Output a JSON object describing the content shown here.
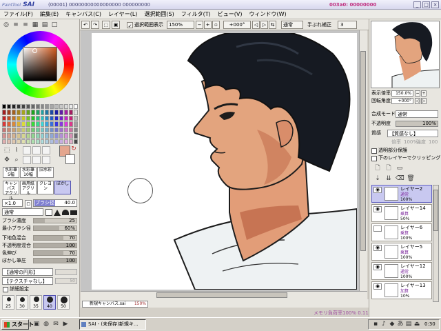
{
  "title_bar": {
    "logo_small": "PaintTool",
    "logo_big": "SAI",
    "title_text": "(00001) 00000000000000000 000000000",
    "memory_text": "003a0: 00000000"
  },
  "menu": [
    "ファイル(F)",
    "編集(E)",
    "キャンバス(C)",
    "レイヤー(L)",
    "選択範囲(S)",
    "フィルタ(T)",
    "ビュー(V)",
    "ウィンドウ(W)"
  ],
  "toolbar": {
    "show_selection_label": "選択範囲表示",
    "zoom": "150%",
    "rotation": "+000°",
    "blend_mode": "通常",
    "stabilizer_label": "手ぶれ補正",
    "stabilizer_value": "3"
  },
  "left": {
    "tool_buttons": [
      {
        "label": "水彩筆",
        "sub": "5幅"
      },
      {
        "label": "水彩筆",
        "sub": "10幅"
      },
      {
        "label": "旧水彩",
        "sub": ""
      },
      {
        "label": "キャンバス",
        "sub": "アクリル"
      },
      {
        "label": "画用紙",
        "sub": "アクリル"
      },
      {
        "label": "クレヨン",
        "sub": ""
      },
      {
        "label": "ぼかし",
        "sub": ""
      }
    ],
    "size_multiplier": "×1.0",
    "brush_size_label": "ブラシ径",
    "brush_size_value": "40.0",
    "blend_mode": "通常",
    "sliders": [
      {
        "label": "ブラシ濃度",
        "value": "25",
        "fraction": 0.25
      },
      {
        "label": "最小ブラシ径",
        "value": "60%",
        "fraction": 0.6
      },
      {
        "label": "下地色混合",
        "value": "70",
        "fraction": 0.7
      },
      {
        "label": "不透明度混合",
        "value": "100",
        "fraction": 1.0
      },
      {
        "label": "色伸び",
        "value": "70",
        "fraction": 0.7
      },
      {
        "label": "ぼかし筆圧",
        "value": "100",
        "fraction": 1.0
      }
    ],
    "shape_dropdown": "【通常の円形】",
    "texture_dropdown": "【テクスチャなし】",
    "texture_value": "50",
    "detail_checkbox": "詳細設定",
    "brush_presets": [
      "25",
      "30",
      "35",
      "40",
      "50"
    ]
  },
  "canvas_tab": {
    "name": "新規キャンバス.sai",
    "zoom": "150%"
  },
  "status": {
    "memory_usage": "メモリ負荷率100%  0.11MB"
  },
  "right": {
    "zoom_label": "表示倍率",
    "zoom_value": "150.0%",
    "angle_label": "回転角度",
    "angle_value": "+000°",
    "mode_label": "合成モード",
    "mode_value": "通常",
    "opacity_label": "不透明度",
    "opacity_value": "100%",
    "texture_label": "質感",
    "texture_value": "【質感なし】",
    "scale_label": "倍率",
    "scale_value": "100%",
    "strength_label": "強度",
    "strength_value": "100",
    "protect_alpha": "透明部分保護",
    "clipping": "下のレイヤーでクリッピング",
    "layers": [
      {
        "name": "レイヤー2",
        "mode": "通常",
        "opacity": "100%",
        "selected": true
      },
      {
        "name": "レイヤー14",
        "mode": "乗算",
        "opacity": "50%",
        "selected": false
      },
      {
        "name": "レイヤー6",
        "mode": "乗算",
        "opacity": "100%",
        "selected": false
      },
      {
        "name": "レイヤー5",
        "mode": "乗算",
        "opacity": "100%",
        "selected": false
      },
      {
        "name": "レイヤー12",
        "mode": "通常",
        "opacity": "100%",
        "selected": false
      },
      {
        "name": "レイヤー13",
        "mode": "加算",
        "opacity": "10%",
        "selected": false
      }
    ]
  },
  "taskbar": {
    "start": "スタート",
    "app_item": "SAI - (未保存)新規キ...",
    "clock": "0:30"
  },
  "colors": {
    "skin": "#e0a27c",
    "skin_shadow": "#c66b4a",
    "hair": "#151920",
    "primary_color": "#e4a68e",
    "secondary_color": "#ffffff"
  }
}
